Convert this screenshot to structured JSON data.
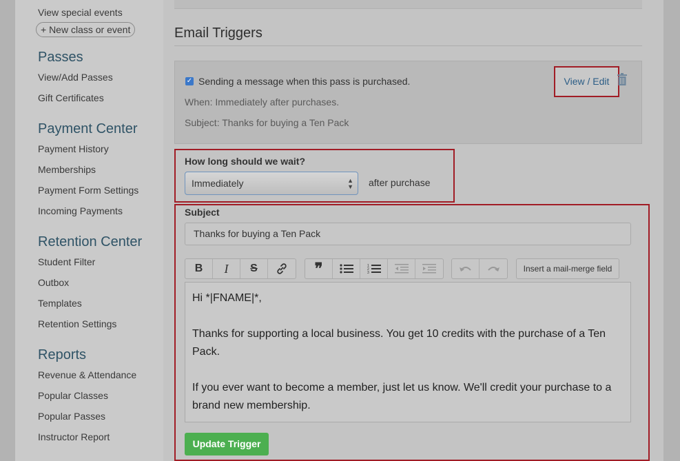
{
  "sidebar": {
    "top_link": "View special events",
    "new_class_button": "+ New class or event",
    "sections": [
      {
        "title": "Passes",
        "items": [
          "View/Add Passes",
          "Gift Certificates"
        ]
      },
      {
        "title": "Payment Center",
        "items": [
          "Payment History",
          "Memberships",
          "Payment Form Settings",
          "Incoming Payments"
        ]
      },
      {
        "title": "Retention Center",
        "items": [
          "Student Filter",
          "Outbox",
          "Templates",
          "Retention Settings"
        ]
      },
      {
        "title": "Reports",
        "items": [
          "Revenue & Attendance",
          "Popular Classes",
          "Popular Passes",
          "Instructor Report"
        ]
      }
    ]
  },
  "main": {
    "title": "Email Triggers",
    "trigger_card": {
      "checked": true,
      "description": "Sending a message when this pass is purchased.",
      "when": "When: Immediately after purchases.",
      "subject": "Subject: Thanks for buying a Ten Pack",
      "view_edit_label": "View / Edit",
      "trash_icon": "trash-icon"
    },
    "wait": {
      "label": "How long should we wait?",
      "selected": "Immediately",
      "suffix": "after purchase"
    },
    "subject": {
      "label": "Subject",
      "value": "Thanks for buying a Ten Pack"
    },
    "toolbar": {
      "bold": "B",
      "italic": "I",
      "strike": "S",
      "link_icon": "link-icon",
      "quote": "❞",
      "bullet_list_icon": "bullet-list-icon",
      "numbered_list_icon": "numbered-list-icon",
      "outdent_icon": "outdent-icon",
      "indent_icon": "indent-icon",
      "undo_icon": "undo-icon",
      "redo_icon": "redo-icon",
      "merge_label": "Insert a mail-merge field"
    },
    "body": {
      "line1": "Hi *|FNAME|*,",
      "para2": "Thanks for supporting a local business. You get 10 credits with the purchase of a Ten Pack.",
      "para3": "If you ever want to become a member, just let us know. We'll credit your purchase to a brand new membership."
    },
    "update_button": "Update Trigger"
  },
  "colors": {
    "heading_blue": "#2f5366",
    "highlight_red": "#a11c25",
    "success_green": "#4caf50",
    "link_blue": "#2b5d86"
  }
}
